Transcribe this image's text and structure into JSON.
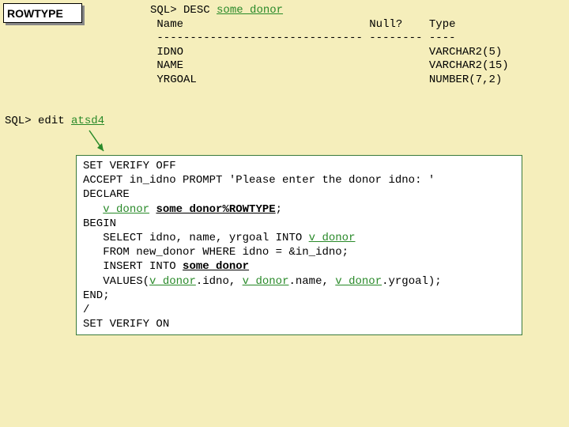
{
  "badge": {
    "label": "ROWTYPE"
  },
  "desc": {
    "prompt": "SQL>",
    "cmd": "DESC",
    "object": "some_donor",
    "header_name": "Name",
    "header_null": "Null?",
    "header_type": "Type",
    "dashes_name": "-------------------------------",
    "dashes_null": "--------",
    "dashes_type": "----",
    "rows": [
      {
        "name": "IDNO",
        "type": "VARCHAR2(5)"
      },
      {
        "name": "NAME",
        "type": "VARCHAR2(15)"
      },
      {
        "name": "YRGOAL",
        "type": "NUMBER(7,2)"
      }
    ]
  },
  "edit": {
    "prompt": "SQL>",
    "cmd": "edit",
    "file": "atsd4"
  },
  "script": {
    "l1": "SET VERIFY OFF",
    "l2a": "ACCEPT in_idno PROMPT 'Please enter the donor idno: '",
    "l3": "DECLARE",
    "l4_var": "v_donor",
    "l4_type": "some_donor%ROWTYPE",
    "l5": "BEGIN",
    "l6a": "SELECT idno, name, yrgoal INTO ",
    "l6_v": "v_donor",
    "l7": "FROM new_donor WHERE idno = &in_idno;",
    "l8a": "INSERT INTO ",
    "l8_t": "some_donor",
    "l9a": "VALUES(",
    "l9_v1": "v_donor",
    "l9_s1": ".idno, ",
    "l9_v2": "v_donor",
    "l9_s2": ".name, ",
    "l9_v3": "v_donor",
    "l9_s3": ".yrgoal);",
    "l10": "END;",
    "l11": "/",
    "l12": "SET VERIFY ON"
  }
}
